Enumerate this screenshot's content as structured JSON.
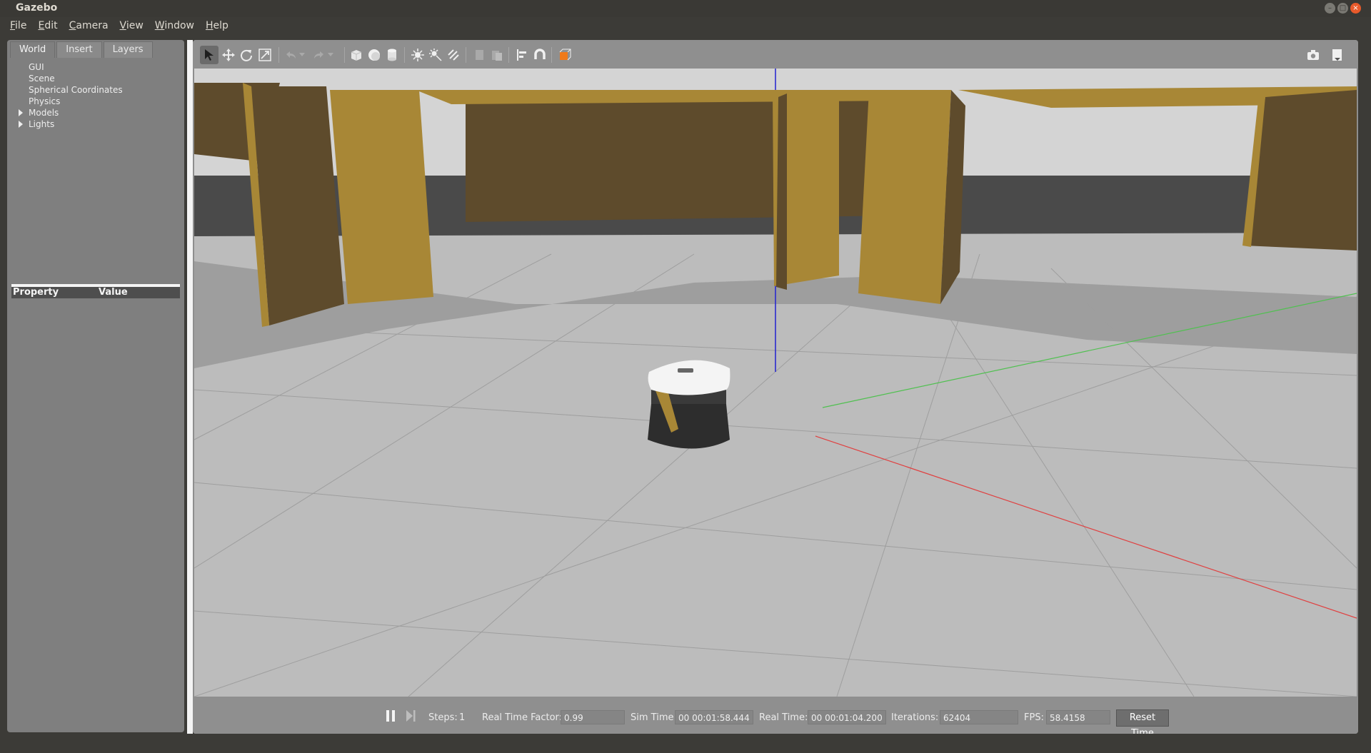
{
  "window": {
    "title": "Gazebo"
  },
  "menu": [
    {
      "underline": "F",
      "rest": "ile"
    },
    {
      "underline": "E",
      "rest": "dit"
    },
    {
      "underline": "C",
      "rest": "amera"
    },
    {
      "underline": "V",
      "rest": "iew"
    },
    {
      "underline": "W",
      "rest": "indow"
    },
    {
      "underline": "H",
      "rest": "elp"
    }
  ],
  "left_panel": {
    "tabs": [
      "World",
      "Insert",
      "Layers"
    ],
    "active_tab": "World",
    "tree": [
      "GUI",
      "Scene",
      "Spherical Coordinates",
      "Physics",
      "Models",
      "Lights"
    ],
    "property_header": {
      "property": "Property",
      "value": "Value"
    }
  },
  "toolbar": {
    "tools": [
      "select-arrow-icon",
      "translate-icon",
      "rotate-icon",
      "scale-icon",
      "undo-icon",
      "redo-icon",
      "box-shape-icon",
      "sphere-shape-icon",
      "cylinder-shape-icon",
      "point-light-icon",
      "spot-light-icon",
      "directional-light-icon",
      "copy-icon",
      "paste-icon",
      "align-icon",
      "snap-magnet-icon",
      "view-angle-icon",
      "screenshot-icon",
      "log-icon"
    ],
    "accent_color": "#f07a1a"
  },
  "status": {
    "steps_label": "Steps:",
    "steps_value": "1",
    "rtf_label": "Real Time Factor:",
    "rtf_value": "0.99",
    "sim_time_label": "Sim Time:",
    "sim_time_value": "00 00:01:58.444",
    "real_time_label": "Real Time:",
    "real_time_value": "00 00:01:04.200",
    "iterations_label": "Iterations:",
    "iterations_value": "62404",
    "fps_label": "FPS:",
    "fps_value": "58.4158",
    "reset_label": "Reset Time"
  },
  "scene_colors": {
    "wall_face": "#5f4c2e",
    "wall_edge": "#a88736",
    "ground": "#bdbdbd",
    "sky": "#d3d3d3",
    "x_axis": "#e04040",
    "y_axis": "#50c050",
    "z_axis": "#2020d0"
  }
}
